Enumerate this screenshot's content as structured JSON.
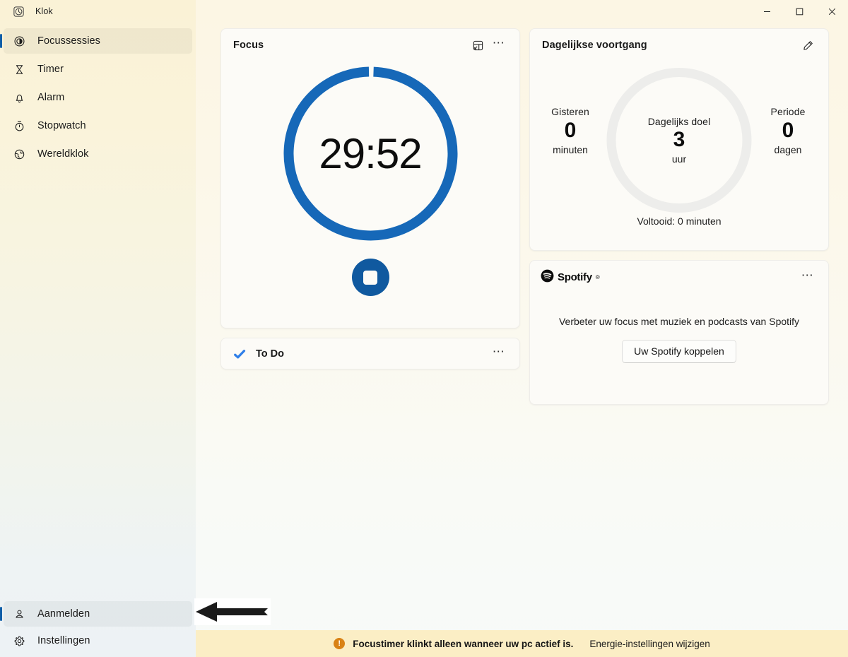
{
  "window": {
    "app_title": "Klok",
    "app_icon": "clock-icon",
    "minimize_label": "Minimaliseren",
    "maximize_label": "Maximaliseren",
    "close_label": "Sluiten"
  },
  "sidebar": {
    "items": [
      {
        "label": "Focussessies",
        "icon": "focus-sessions-icon",
        "selected": true
      },
      {
        "label": "Timer",
        "icon": "hourglass-icon",
        "selected": false
      },
      {
        "label": "Alarm",
        "icon": "bell-icon",
        "selected": false
      },
      {
        "label": "Stopwatch",
        "icon": "stopwatch-icon",
        "selected": false
      },
      {
        "label": "Wereldklok",
        "icon": "globe-icon",
        "selected": false
      }
    ],
    "bottom_items": [
      {
        "label": "Aanmelden",
        "icon": "person-icon",
        "selected": true
      },
      {
        "label": "Instellingen",
        "icon": "gear-icon",
        "selected": false
      }
    ]
  },
  "focus_card": {
    "title": "Focus",
    "popout_icon": "compact-overlay-icon",
    "more_icon": "more-options-icon",
    "timer_value": "29:52",
    "ring_progress_percent": 99,
    "ring_color": "#1668b8",
    "stop_button_label": "Stoppen",
    "stop_icon": "stop-icon"
  },
  "todo_card": {
    "title": "To Do",
    "icon": "to-do-checkmark-icon",
    "more_icon": "more-options-icon"
  },
  "progress_card": {
    "title": "Dagelijkse voortgang",
    "edit_icon": "pencil-edit-icon",
    "left_stat": {
      "label": "Gisteren",
      "value": "0",
      "unit": "minuten"
    },
    "goal": {
      "label": "Dagelijks doel",
      "value": "3",
      "unit": "uur",
      "progress_percent": 0,
      "track_color": "#ededeb"
    },
    "right_stat": {
      "label": "Periode",
      "value": "0",
      "unit": "dagen"
    },
    "completed_text": "Voltooid: 0 minuten"
  },
  "spotify_card": {
    "brand": "Spotify",
    "brand_tm": "®",
    "logo_icon": "spotify-logo-icon",
    "more_icon": "more-options-icon",
    "description": "Verbeter uw focus met muziek en podcasts van Spotify",
    "connect_button": "Uw Spotify koppelen"
  },
  "notice_bar": {
    "icon": "warning-icon",
    "icon_glyph": "!",
    "message": "Focustimer klinkt alleen wanneer uw pc actief is.",
    "link": "Energie-instellingen wijzigen",
    "background": "#fbeec5"
  },
  "annotation": {
    "arrow": "left-pointing-arrow",
    "points_at": "Aanmelden"
  }
}
